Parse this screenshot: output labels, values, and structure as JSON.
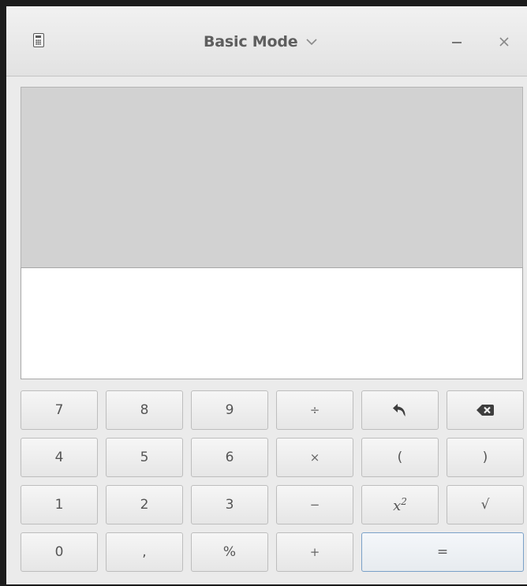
{
  "window": {
    "title": "Basic Mode"
  },
  "keypad": {
    "rows": [
      [
        {
          "label": "7",
          "name": "key-7"
        },
        {
          "label": "8",
          "name": "key-8"
        },
        {
          "label": "9",
          "name": "key-9"
        },
        {
          "label": "÷",
          "name": "key-divide"
        },
        {
          "label": "",
          "name": "undo-button",
          "icon": "undo-icon"
        },
        {
          "label": "",
          "name": "backspace-button",
          "icon": "backspace-icon"
        }
      ],
      [
        {
          "label": "4",
          "name": "key-4"
        },
        {
          "label": "5",
          "name": "key-5"
        },
        {
          "label": "6",
          "name": "key-6"
        },
        {
          "label": "×",
          "name": "key-multiply"
        },
        {
          "label": "(",
          "name": "key-open-paren"
        },
        {
          "label": ")",
          "name": "key-close-paren"
        }
      ],
      [
        {
          "label": "1",
          "name": "key-1"
        },
        {
          "label": "2",
          "name": "key-2"
        },
        {
          "label": "3",
          "name": "key-3"
        },
        {
          "label": "−",
          "name": "key-subtract"
        },
        {
          "label": "x",
          "superscript": "2",
          "name": "key-square"
        },
        {
          "label": "√",
          "name": "key-sqrt"
        }
      ],
      [
        {
          "label": "0",
          "name": "key-0"
        },
        {
          "label": ",",
          "name": "key-decimal"
        },
        {
          "label": "%",
          "name": "key-percent"
        },
        {
          "label": "+",
          "name": "key-add"
        },
        {
          "label": "=",
          "name": "key-equals",
          "wide": true
        }
      ]
    ]
  },
  "colors": {
    "history_bg": "#d2d2d2",
    "entry_bg": "#ffffff",
    "equals_border": "#7aa1c8"
  }
}
